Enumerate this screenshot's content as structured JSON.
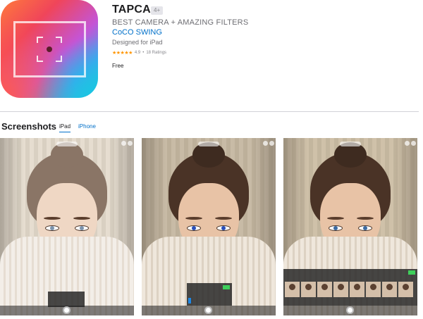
{
  "app": {
    "title": "TAPCA",
    "age_rating": "4+",
    "subtitle": "BEST CAMERA + AMAZING FILTERS",
    "developer": "CoCO SWING",
    "designed_for": "Designed for iPad",
    "stars": "★★★★★",
    "rating": "4.9",
    "rating_sep": "•",
    "ratings_count": "18 Ratings",
    "price": "Free"
  },
  "screenshots": {
    "title": "Screenshots",
    "tabs": [
      {
        "label": "iPad",
        "active": true
      },
      {
        "label": "iPhone",
        "active": false
      }
    ]
  },
  "colors": {
    "link": "#0070c9",
    "star": "#ff9500",
    "save_green": "#3ecf5b",
    "active_tab_blue": "#1e88e5"
  }
}
